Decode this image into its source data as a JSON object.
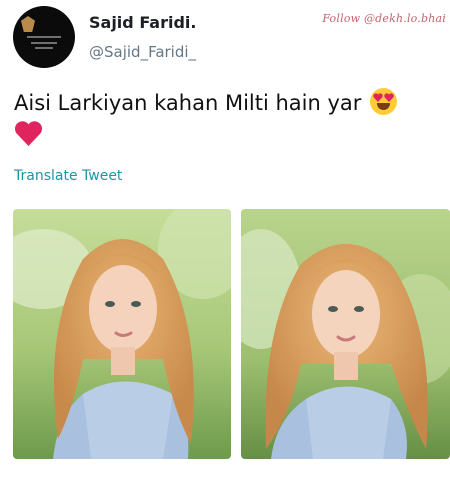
{
  "tweet": {
    "author": {
      "name": "Sajid Faridi.",
      "handle": "@Sajid_Faridi_",
      "avatar_icon": "profile-logo"
    },
    "watermark": "Follow @dekh.lo.bhai",
    "text": "Aisi Larkiyan kahan Milti hain yar",
    "emojis": [
      "smiling-face-heart-eyes-emoji",
      "red-heart-emoji"
    ],
    "translate_label": "Translate Tweet",
    "media": [
      {
        "icon": "photo"
      },
      {
        "icon": "photo"
      }
    ]
  },
  "colors": {
    "link": "#1b95a8",
    "handle": "#657786",
    "watermark": "#c0646f",
    "heart": "#e0245e"
  }
}
